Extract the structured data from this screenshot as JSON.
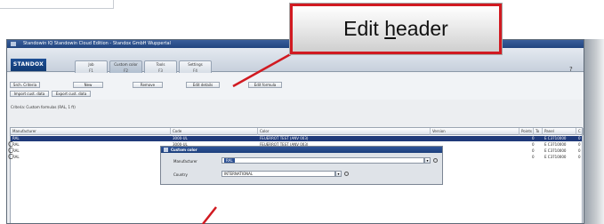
{
  "window": {
    "title": "Standowin IQ Standowin Cloud Edition - Standox GmbH Wuppertal"
  },
  "brand": {
    "logo_text": "STANDOX"
  },
  "tabs": [
    {
      "label": "Job",
      "key": "F1"
    },
    {
      "label": "Custom color",
      "key": "F2"
    },
    {
      "label": "Tools",
      "key": "F3"
    },
    {
      "label": "Settings",
      "key": "F4"
    }
  ],
  "toolbar": {
    "search": "Srch. Criteria",
    "new": "New",
    "remove": "Remove",
    "edit_details": "Edit details",
    "edit_formula": "Edit formula",
    "import": "Import cust. data",
    "export": "Export cust. data"
  },
  "criteria_text": "Criteria: Custom formulas (RAL, 1 ft)",
  "help_icon": "?",
  "table": {
    "columns": [
      "Manufacturer",
      "Code",
      "Color",
      "Version",
      "Points",
      "To",
      "Panel",
      "C"
    ],
    "rows": [
      [
        "RAL",
        "3000-UL",
        "FEUERROT TEST (ANV 003)",
        "",
        "0",
        "",
        "E C3710000",
        "0"
      ],
      [
        "RAL",
        "3000-UL",
        "FEUERROT TEST (ANV 003)",
        "",
        "0",
        "",
        "E C3710000",
        "0"
      ],
      [
        "RAL",
        "3000-UL",
        "FEUERROT TEST (ANV 003)",
        "",
        "0",
        "",
        "E C3710000",
        "0"
      ],
      [
        "RAL",
        "3000-UL",
        "FEUERROT TEST (ANV 003)",
        "",
        "0",
        "",
        "E C3710000",
        "0"
      ]
    ]
  },
  "dialog": {
    "title": "Custom color",
    "manufacturer_label": "Manufacturer",
    "manufacturer_value": "RAL",
    "country_label": "Country",
    "country_value": "INTERNATIONAL"
  },
  "callout": {
    "text_before": "Edit ",
    "underlined": "h",
    "text_after": "eader"
  },
  "colors": {
    "callout_border": "#d11a21",
    "selection": "#1f3a7a",
    "title_bar": "#21457f"
  }
}
